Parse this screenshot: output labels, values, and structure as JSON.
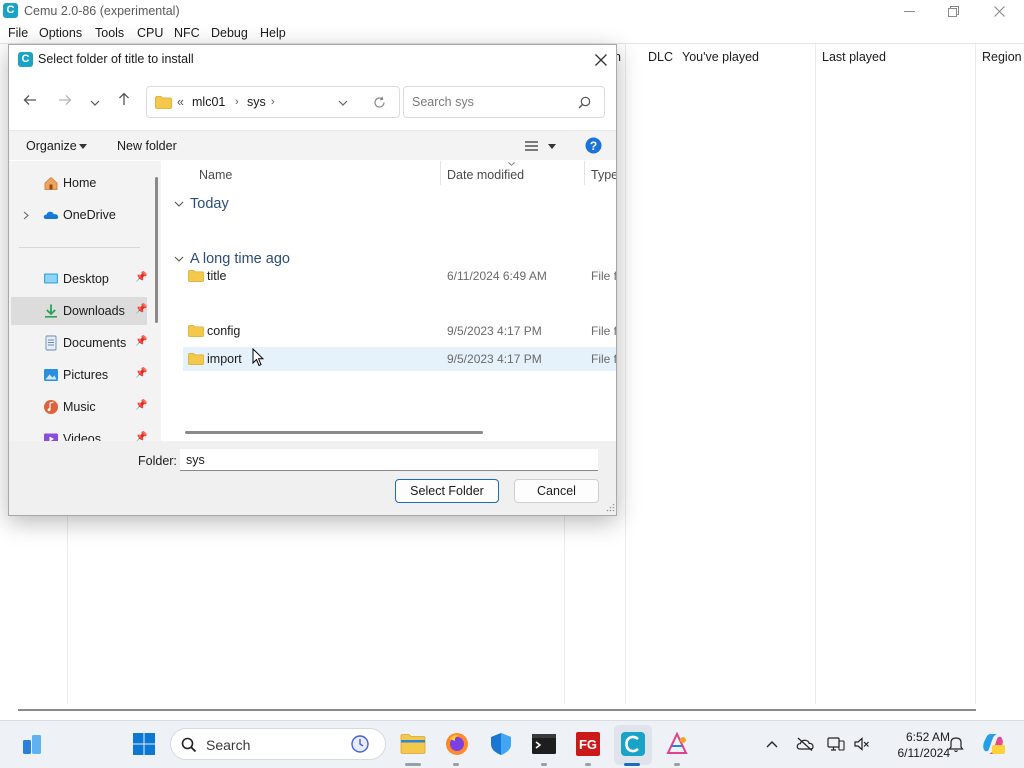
{
  "window": {
    "title": "Cemu 2.0-86 (experimental)",
    "logo_letter": "C"
  },
  "menu": [
    "File",
    "Options",
    "Tools",
    "CPU",
    "NFC",
    "Debug",
    "Help"
  ],
  "game_list": {
    "columns": [
      "DLC",
      "You've played",
      "Last played",
      "Region"
    ],
    "partial_column": "n"
  },
  "dialog": {
    "title": "Select folder of title to install",
    "address": {
      "overflow": "«",
      "segments": [
        "mlc01",
        "sys"
      ]
    },
    "search_placeholder": "Search sys",
    "commands": {
      "organize": "Organize",
      "new_folder": "New folder"
    },
    "nav_items": [
      {
        "label": "Home",
        "icon": "home-icon"
      },
      {
        "label": "OneDrive",
        "icon": "onedrive-cloud-icon"
      },
      {
        "label": "Desktop",
        "icon": "desktop-icon"
      },
      {
        "label": "Downloads",
        "icon": "downloads-icon"
      },
      {
        "label": "Documents",
        "icon": "documents-icon"
      },
      {
        "label": "Pictures",
        "icon": "pictures-icon"
      },
      {
        "label": "Music",
        "icon": "music-icon"
      },
      {
        "label": "Videos",
        "icon": "videos-icon"
      }
    ],
    "columns": {
      "name": "Name",
      "date": "Date modified",
      "type": "Type"
    },
    "groups": [
      {
        "label": "Today",
        "rows": [
          {
            "name": "title",
            "date": "6/11/2024 6:49 AM",
            "type": "File fo"
          }
        ]
      },
      {
        "label": "A long time ago",
        "rows": [
          {
            "name": "config",
            "date": "9/5/2023 4:17 PM",
            "type": "File fo"
          },
          {
            "name": "import",
            "date": "9/5/2023 4:17 PM",
            "type": "File fo"
          }
        ]
      }
    ],
    "folder_label": "Folder:",
    "folder_value": "sys",
    "select_button": "Select Folder",
    "cancel_button": "Cancel"
  },
  "taskbar": {
    "search_text": "Search",
    "clock": {
      "time": "6:52 AM",
      "date": "6/11/2024"
    },
    "fg_label": "FG"
  },
  "colors": {
    "accent_blue": "#1a6bbf",
    "folder_yellow": "#f4c84a",
    "cemu_teal": "#1aa3c6",
    "hover_row": "#e5f1fb"
  }
}
